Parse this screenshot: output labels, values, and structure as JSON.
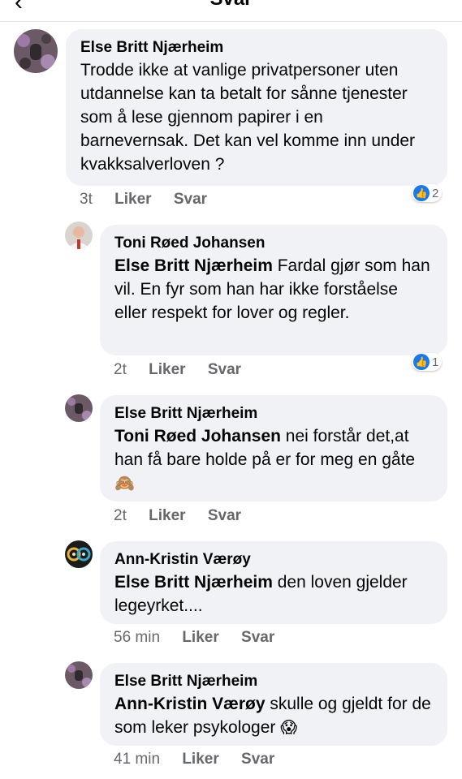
{
  "header": {
    "title": "Svar",
    "back_icon": "arrow-left-icon"
  },
  "comments": [
    {
      "author": "Else Britt Njærheim",
      "text": "Trodde ikke at vanlige privatpersoner uten utdannelse kan ta betalt for sånne tjenester som å lese gjennom papirer i en barnevernsak. Det kan vel komme inn under kvakksalverloven ?",
      "time": "3t",
      "like_label": "Liker",
      "reply_label": "Svar",
      "reaction_count": "2"
    },
    {
      "author": "Toni Røed Johansen",
      "mention": "Else Britt Njærheim",
      "text": " Fardal gjør som han vil. En fyr som han har ikke forståelse eller respekt for lover og regler.",
      "time": "2t",
      "like_label": "Liker",
      "reply_label": "Svar",
      "reaction_count": "1"
    },
    {
      "author": "Else Britt Njærheim",
      "mention": "Toni Røed Johansen",
      "text": " nei forstår det,at han få bare holde på er for meg en gåte ",
      "emoji": "🙈",
      "time": "2t",
      "like_label": "Liker",
      "reply_label": "Svar"
    },
    {
      "author": "Ann-Kristin Værøy",
      "mention": "Else Britt Njærheim",
      "text": " den loven gjelder legeyrket....",
      "time": "56 min",
      "like_label": "Liker",
      "reply_label": "Svar"
    },
    {
      "author": "Else Britt Njærheim",
      "mention": "Ann-Kristin Værøy",
      "text": " skulle og gjeldt for de som leker psykologer ",
      "emoji": "😱",
      "time": "41 min",
      "like_label": "Liker",
      "reply_label": "Svar"
    }
  ]
}
